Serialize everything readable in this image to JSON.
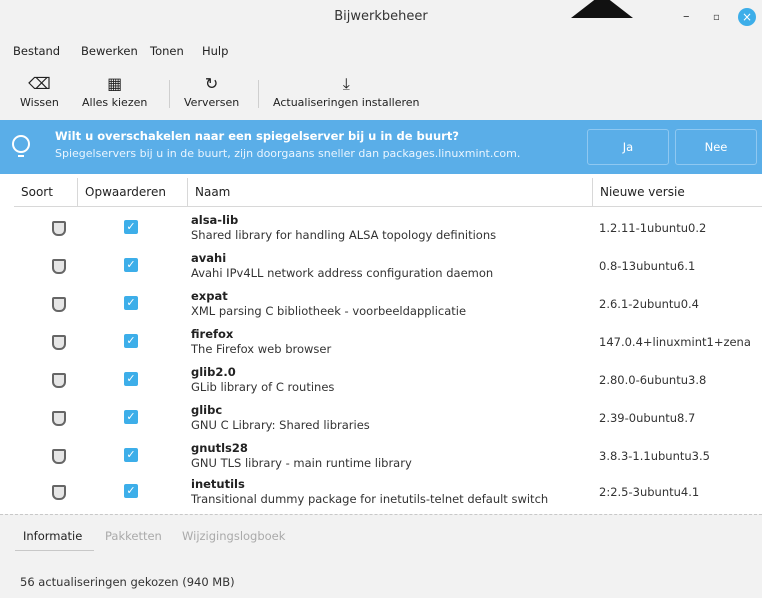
{
  "window": {
    "title": "Bijwerkbeheer",
    "controls": {
      "minimize": "–",
      "maximize": "▫",
      "close": "×"
    }
  },
  "menu": {
    "items": [
      {
        "label": "Bestand"
      },
      {
        "label": "Bewerken"
      },
      {
        "label": "Tonen"
      },
      {
        "label": "Hulp"
      }
    ]
  },
  "toolbar": {
    "buttons": [
      {
        "label": "Wissen",
        "icon": "clear-icon"
      },
      {
        "label": "Alles kiezen",
        "icon": "select-all-icon"
      },
      {
        "label": "Verversen",
        "icon": "refresh-icon"
      },
      {
        "label": "Actualiseringen installeren",
        "icon": "download-icon"
      }
    ]
  },
  "infobar": {
    "title": "Wilt u overschakelen naar een spiegelserver bij u in de buurt?",
    "subtitle": "Spiegelservers bij u in de buurt, zijn doorgaans sneller dan packages.linuxmint.com.",
    "yes_label": "Ja",
    "no_label": "Nee"
  },
  "table": {
    "headers": {
      "type": "Soort",
      "upgrade": "Opwaarderen",
      "name": "Naam",
      "new_version": "Nieuwe versie"
    },
    "rows": [
      {
        "name": "alsa-lib",
        "desc": "Shared library for handling ALSA topology definitions",
        "version": "1.2.11-1ubuntu0.2",
        "checked": true
      },
      {
        "name": "avahi",
        "desc": "Avahi IPv4LL network address configuration daemon",
        "version": "0.8-13ubuntu6.1",
        "checked": true
      },
      {
        "name": "expat",
        "desc": "XML parsing C bibliotheek - voorbeeldapplicatie",
        "version": "2.6.1-2ubuntu0.4",
        "checked": true
      },
      {
        "name": "firefox",
        "desc": "The Firefox web browser",
        "version": "147.0.4+linuxmint1+zena",
        "checked": true
      },
      {
        "name": "glib2.0",
        "desc": "GLib library of C routines",
        "version": "2.80.0-6ubuntu3.8",
        "checked": true
      },
      {
        "name": "glibc",
        "desc": "GNU C Library: Shared libraries",
        "version": "2.39-0ubuntu8.7",
        "checked": true
      },
      {
        "name": "gnutls28",
        "desc": "GNU TLS library - main runtime library",
        "version": "3.8.3-1.1ubuntu3.5",
        "checked": true
      },
      {
        "name": "inetutils",
        "desc": "Transitional dummy package for inetutils-telnet default switch",
        "version": "2:2.5-3ubuntu4.1",
        "checked": true
      }
    ]
  },
  "bottom": {
    "tabs": [
      {
        "label": "Informatie"
      },
      {
        "label": "Pakketten"
      },
      {
        "label": "Wijzigingslogboek"
      }
    ],
    "status": "56 actualiseringen gekozen (940 MB)"
  },
  "colors": {
    "accent": "#3daee9",
    "infobar": "#5aaee8",
    "window_bg": "#f2f2f2"
  }
}
